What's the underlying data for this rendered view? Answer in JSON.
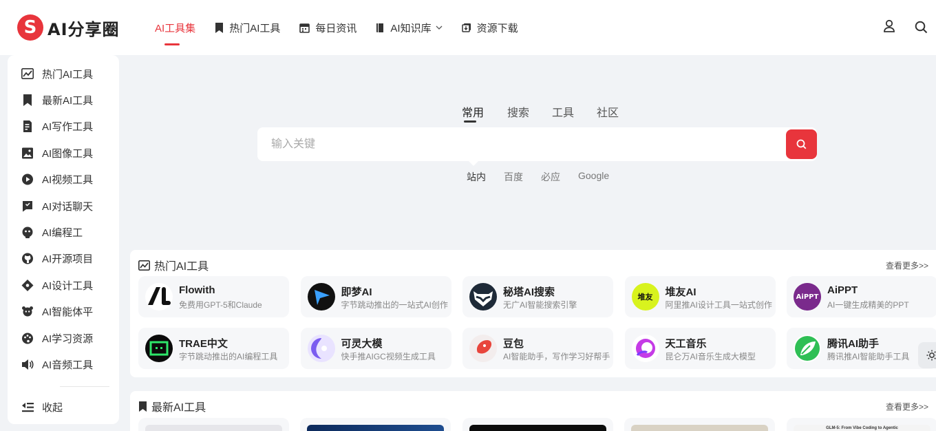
{
  "header": {
    "logo_badge": "S",
    "logo_text": "AI分享圈",
    "nav": [
      {
        "label": "AI工具集",
        "active": true
      },
      {
        "label": "热门AI工具"
      },
      {
        "label": "每日资讯"
      },
      {
        "label": "AI知识库"
      },
      {
        "label": "资源下载"
      }
    ]
  },
  "sidebar": {
    "items": [
      {
        "label": "热门AI工具",
        "icon": "trending-chart-icon"
      },
      {
        "label": "最新AI工具",
        "icon": "bookmark-icon"
      },
      {
        "label": "AI写作工具",
        "icon": "document-edit-icon"
      },
      {
        "label": "AI图像工具",
        "icon": "image-icon"
      },
      {
        "label": "AI视频工具",
        "icon": "play-circle-icon"
      },
      {
        "label": "AI对话聊天",
        "icon": "chat-icon"
      },
      {
        "label": "AI编程工",
        "icon": "robot-icon"
      },
      {
        "label": "AI开源项目",
        "icon": "github-icon"
      },
      {
        "label": "AI设计工具",
        "icon": "design-icon"
      },
      {
        "label": "AI智能体平",
        "icon": "agent-icon"
      },
      {
        "label": "AI学习资源",
        "icon": "palette-icon"
      },
      {
        "label": "AI音频工具",
        "icon": "speaker-icon"
      }
    ],
    "collapse_label": "收起"
  },
  "search": {
    "tabs": [
      "常用",
      "搜索",
      "工具",
      "社区"
    ],
    "active_tab": 0,
    "placeholder": "输入关键",
    "engines": [
      "站内",
      "百度",
      "必应",
      "Google"
    ],
    "active_engine": 0
  },
  "hot_section": {
    "title": "热门AI工具",
    "more": "查看更多>>",
    "cards": [
      {
        "title": "Flowith",
        "desc": "免费用GPT-5和Claude",
        "icon_bg": "#ffffff",
        "icon_fg": "#111111",
        "glyph": "fl"
      },
      {
        "title": "即梦AI",
        "desc": "字节跳动推出的一站式AI创作平台",
        "icon_bg": "#111111",
        "icon_fg": "#3aa0ff",
        "glyph": "play"
      },
      {
        "title": "秘塔AI搜索",
        "desc": "无广AI智能搜索引擎",
        "icon_bg": "#1e2a38",
        "icon_fg": "#ffffff",
        "glyph": "raccoon"
      },
      {
        "title": "堆友AI",
        "desc": "阿里推AI设计工具一站式创作平台",
        "icon_bg": "#d8f31e",
        "icon_fg": "#111111",
        "glyph": "堆友"
      },
      {
        "title": "AiPPT",
        "desc": "AI一键生成精美的PPT",
        "icon_bg": "#7a2a8c",
        "icon_fg": "#ffffff",
        "glyph": "AiPPT"
      },
      {
        "title": "TRAE中文",
        "desc": "字节跳动推出的AI编程工具",
        "icon_bg": "#0b0b0b",
        "icon_fg": "#2ee56a",
        "glyph": "trae"
      },
      {
        "title": "可灵大模",
        "desc": "快手推AIGC视频生成工具",
        "icon_bg": "#e9e3ff",
        "icon_fg": "#7b5cf0",
        "glyph": "kling"
      },
      {
        "title": "豆包",
        "desc": "AI智能助手，写作学习好帮手",
        "icon_bg": "#f3eded",
        "icon_fg": "#e8453c",
        "glyph": "doubao"
      },
      {
        "title": "天工音乐",
        "desc": "昆仑万AI音乐生成大模型",
        "icon_bg": "#ffffff",
        "icon_fg": "#c53be6",
        "glyph": "tg"
      },
      {
        "title": "腾讯AI助手",
        "desc": "腾讯推AI智能助手工具",
        "icon_bg": "#ffffff",
        "icon_fg": "#2fbf55",
        "glyph": "leaf"
      }
    ]
  },
  "new_section": {
    "title": "最新AI工具",
    "more": "查看更多>>",
    "thumb_text": "GLM-5: From Vibe Coding to Agentic"
  }
}
